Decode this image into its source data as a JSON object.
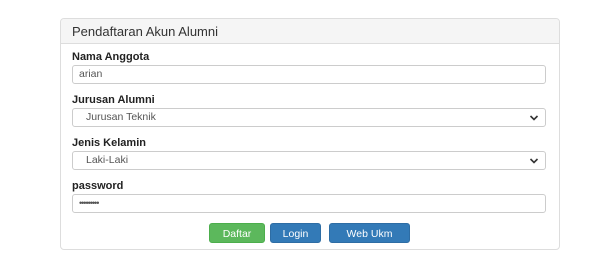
{
  "panel": {
    "title": "Pendaftaran Akun Alumni"
  },
  "form": {
    "nama": {
      "label": "Nama Anggota",
      "value": "arian"
    },
    "jurusan": {
      "label": "Jurusan Alumni",
      "selected": "Jurusan Teknik"
    },
    "jenis_kelamin": {
      "label": "Jenis Kelamin",
      "selected": "Laki-Laki"
    },
    "password": {
      "label": "password",
      "value_masked": "•••••••••"
    }
  },
  "buttons": {
    "daftar": "Daftar",
    "login": "Login",
    "web_ukm": "Web Ukm"
  },
  "colors": {
    "success": "#5cb85c",
    "primary": "#337ab7",
    "panel_heading_bg": "#f5f5f5"
  },
  "icons": {
    "select_caret": "chevron-down-icon"
  }
}
